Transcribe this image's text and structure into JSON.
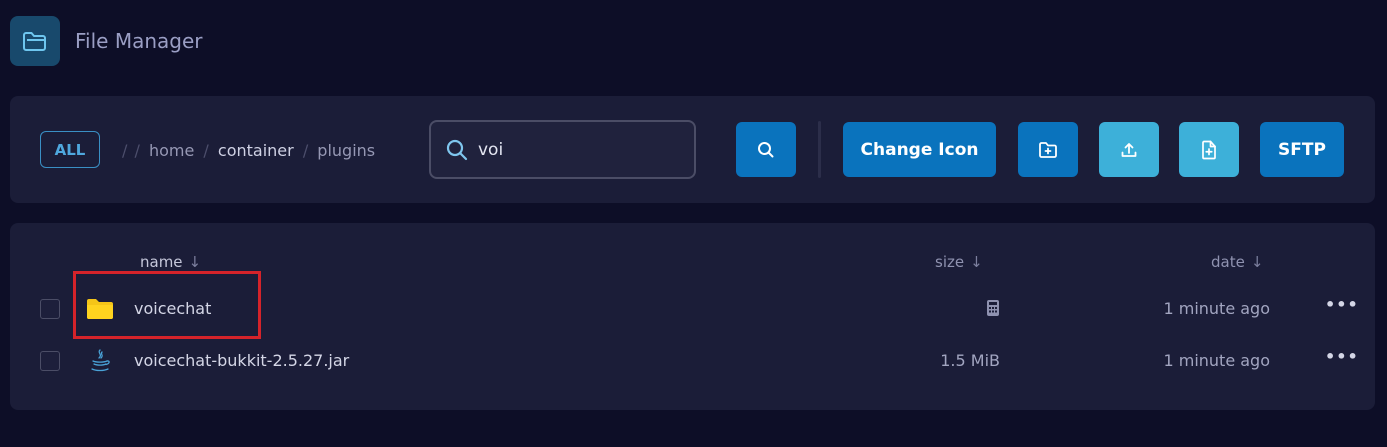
{
  "app": {
    "title": "File Manager",
    "icon": "folder-open-icon"
  },
  "toolbar": {
    "all_label": "ALL",
    "breadcrumb": {
      "leading_sep": "/",
      "items": [
        "home",
        "container",
        "plugins"
      ],
      "sep": "/"
    },
    "search": {
      "value": "voi",
      "icon": "search-icon"
    },
    "search_button_icon": "search-icon",
    "change_icon_label": "Change Icon",
    "new_folder_icon": "folder-plus-icon",
    "upload_icon": "upload-icon",
    "new_file_icon": "file-plus-icon",
    "sftp_label": "SFTP",
    "colors": {
      "primary": "#0a73bd",
      "secondary": "#3db0d9",
      "accent": "#4fa8de"
    }
  },
  "files": {
    "columns": {
      "name": "name",
      "size": "size",
      "date": "date",
      "sort_arrow": "↓"
    },
    "rows": [
      {
        "name": "voicechat",
        "type": "folder",
        "icon": "folder-icon",
        "size": "",
        "size_icon": "calculator-icon",
        "date": "1 minute ago",
        "menu": "•••",
        "highlighted": true
      },
      {
        "name": "voicechat-bukkit-2.5.27.jar",
        "type": "jar",
        "icon": "java-icon",
        "size": "1.5 MiB",
        "date": "1 minute ago",
        "menu": "•••",
        "highlighted": false
      }
    ],
    "highlight_color": "#d5232a"
  }
}
